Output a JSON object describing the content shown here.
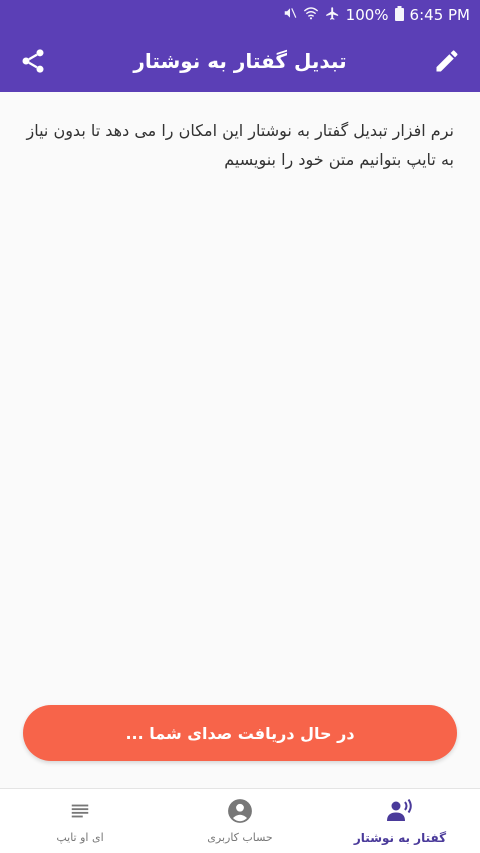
{
  "status_bar": {
    "battery": "100%",
    "time": "6:45 PM",
    "icons": [
      "mute-icon",
      "wifi-icon",
      "airplane-icon",
      "battery-icon"
    ]
  },
  "app_bar": {
    "title": "تبدیل گفتار به نوشتار",
    "left_icon": "share-icon",
    "right_icon": "edit-icon",
    "color": "#5b3fb6"
  },
  "content": {
    "text": "نرم افزار تبدیل گفتار به نوشتار این امکان را می دهد تا بدون نیاز به تایپ بتوانیم متن خود را بنویسیم"
  },
  "record_button": {
    "label": "در حال دریافت صدای شما ...",
    "color": "#f7644a"
  },
  "bottom_nav": {
    "items": [
      {
        "label": "گفتار به نوشتار",
        "icon": "voice-person-icon",
        "active": true
      },
      {
        "label": "حساب کاربری",
        "icon": "account-icon",
        "active": false
      },
      {
        "label": "ای او تایپ",
        "icon": "text-lines-icon",
        "active": false
      }
    ]
  }
}
